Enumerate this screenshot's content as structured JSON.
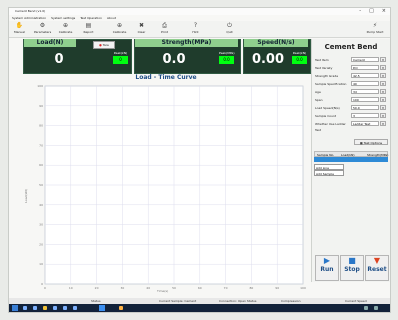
{
  "window": {
    "title": "Cement Bend (v1.0)",
    "menu": [
      "System Administration",
      "System settings",
      "Test Operation",
      "About"
    ],
    "controls": [
      "-",
      "□",
      "×"
    ]
  },
  "toolbar": {
    "items": [
      {
        "label": "Manual",
        "icon": "hand-icon"
      },
      {
        "label": "Parameters",
        "icon": "settings-icon"
      },
      {
        "label": "Calibrate",
        "icon": "calibrate-icon"
      },
      {
        "label": "Report",
        "icon": "report-icon"
      },
      {
        "label": "Calibrate",
        "icon": "calibrate-icon"
      },
      {
        "label": "Clear",
        "icon": "clear-icon"
      },
      {
        "label": "Print",
        "icon": "print-icon"
      },
      {
        "label": "Hint",
        "icon": "hint-icon"
      },
      {
        "label": "Quit",
        "icon": "quit-icon"
      },
      {
        "label": "Pump Start",
        "icon": "pump-icon"
      }
    ]
  },
  "load_panel": {
    "title": "Load(N)",
    "value": "0",
    "tare": "Tare",
    "peak_label": "Peak(kN)",
    "peak_value": "0"
  },
  "strength_panel": {
    "title": "Strength(MPa)",
    "value": "0.0",
    "peak_label": "Peak(MPa)",
    "peak_value": "0.0"
  },
  "speed_panel": {
    "title": "Speed(N/s)",
    "value": "0.00",
    "peak_label": "Peak(kN)",
    "peak_value": "0.0"
  },
  "chart_data": {
    "type": "line",
    "title": "Load - Time Curve",
    "xlabel": "Time(s)",
    "ylabel": "Load(kN)",
    "grid": true,
    "xlim": [
      0,
      100
    ],
    "ylim": [
      0,
      100
    ],
    "xticks": [
      "0",
      "10",
      "20",
      "30",
      "40",
      "50",
      "60",
      "70",
      "80",
      "90",
      "100"
    ],
    "yticks": [
      "100",
      "90",
      "80",
      "70",
      "60",
      "50",
      "40",
      "30",
      "20",
      "10",
      "0"
    ],
    "series": []
  },
  "right_panel": {
    "header": "Cement Bend",
    "params": [
      {
        "label": "Test Item",
        "value": "Cement"
      },
      {
        "label": "Test Variety",
        "value": "P.O"
      },
      {
        "label": "Strength Grade",
        "value": "42.5"
      },
      {
        "label": "Sample Specification",
        "value": "40"
      },
      {
        "label": "Age",
        "value": "3d"
      },
      {
        "label": "Span",
        "value": "100"
      },
      {
        "label": "Load Speed(N/s)",
        "value": "50.0"
      },
      {
        "label": "Sample Count",
        "value": "3"
      },
      {
        "label": "Whether Use Ladder Test",
        "value": "Ladder Test"
      }
    ],
    "options_button": "Test Options",
    "table_headers": [
      "Sample No.",
      "Load(kN)",
      "Strength(MPa)"
    ],
    "list_items": [
      "Add Line",
      "Add Sample"
    ],
    "buttons": {
      "run": "Run",
      "stop": "Stop",
      "reset": "Reset"
    }
  },
  "status": {
    "items": [
      "Status",
      "Current Sample: Cement",
      "Connection: Open Status",
      "Compression",
      "Current Speed"
    ]
  }
}
